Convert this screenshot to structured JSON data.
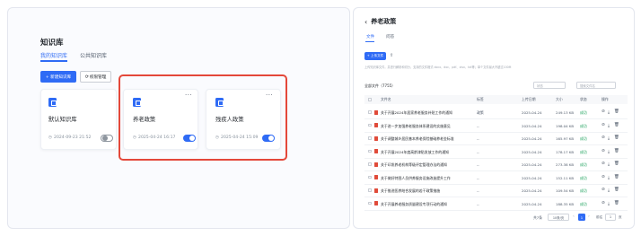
{
  "left": {
    "title": "知识库",
    "tabs": [
      {
        "label": "我的知识库",
        "active": true
      },
      {
        "label": "公共知识库",
        "active": false
      }
    ],
    "new_button": "+ 新建知识库",
    "manage_button": "权限管理",
    "cards": [
      {
        "name": "默认知识库",
        "date": "2024-09-23 21:52",
        "enabled": false,
        "more": false
      },
      {
        "name": "养老政策",
        "date": "2025-04-24 16:17",
        "enabled": true,
        "more": true
      },
      {
        "name": "残疾人政策",
        "date": "2025-04-24 15:09",
        "enabled": true,
        "more": true
      }
    ]
  },
  "right": {
    "title": "养老政策",
    "tabs": [
      {
        "label": "文件",
        "active": true
      },
      {
        "label": "问答",
        "active": false
      }
    ],
    "upload_button": "+ 上传文件",
    "hint": "上传知识库文件，并进行解析和切分，支持的文件格式 docx、doc、pdf、xlsx、txt等；单个文件最大不超过100M",
    "file_count": "全部文件（7755）",
    "filter_placeholder": "状态",
    "search_placeholder": "搜索文件名",
    "columns": [
      "文件名",
      "标签",
      "上传日期",
      "大小",
      "状态",
      "操作"
    ],
    "rows": [
      {
        "name": "关于开展2024年居家养老服务补贴工作的通知",
        "tag": "政策",
        "date": "2025-04-24",
        "size": "249.13 KB",
        "status": "成功"
      },
      {
        "name": "关于进一步加强养老服务体系建设的实施意见",
        "tag": "--",
        "date": "2025-04-24",
        "size": "198.04 KB",
        "status": "成功"
      },
      {
        "name": "关于调整城乡居民基本养老保险基础养老金标准",
        "tag": "--",
        "date": "2025-04-24",
        "size": "165.97 KB",
        "status": "成功"
      },
      {
        "name": "关于开展2024年度高龄津贴发放工作的通知",
        "tag": "--",
        "date": "2025-04-24",
        "size": "178.17 KB",
        "status": "成功"
      },
      {
        "name": "关于印发养老机构等级评定管理办法的通知",
        "tag": "--",
        "date": "2025-04-24",
        "size": "273.38 KB",
        "status": "成功"
      },
      {
        "name": "关于做好特困人员供养服务设施改造提升工作",
        "tag": "--",
        "date": "2025-04-24",
        "size": "152.11 KB",
        "status": "成功"
      },
      {
        "name": "关于推进医养结合发展的若干政策措施",
        "tag": "--",
        "date": "2025-04-24",
        "size": "109.54 KB",
        "status": "成功"
      },
      {
        "name": "关于开展养老服务质量建设专项行动的通知",
        "tag": "--",
        "date": "2025-04-24",
        "size": "188.35 KB",
        "status": "成功"
      }
    ],
    "pagination": {
      "total": "共7条",
      "per_page": "10条/页",
      "current": "1",
      "jump_label": "前往",
      "jump_value": "1",
      "jump_suffix": "页"
    }
  }
}
